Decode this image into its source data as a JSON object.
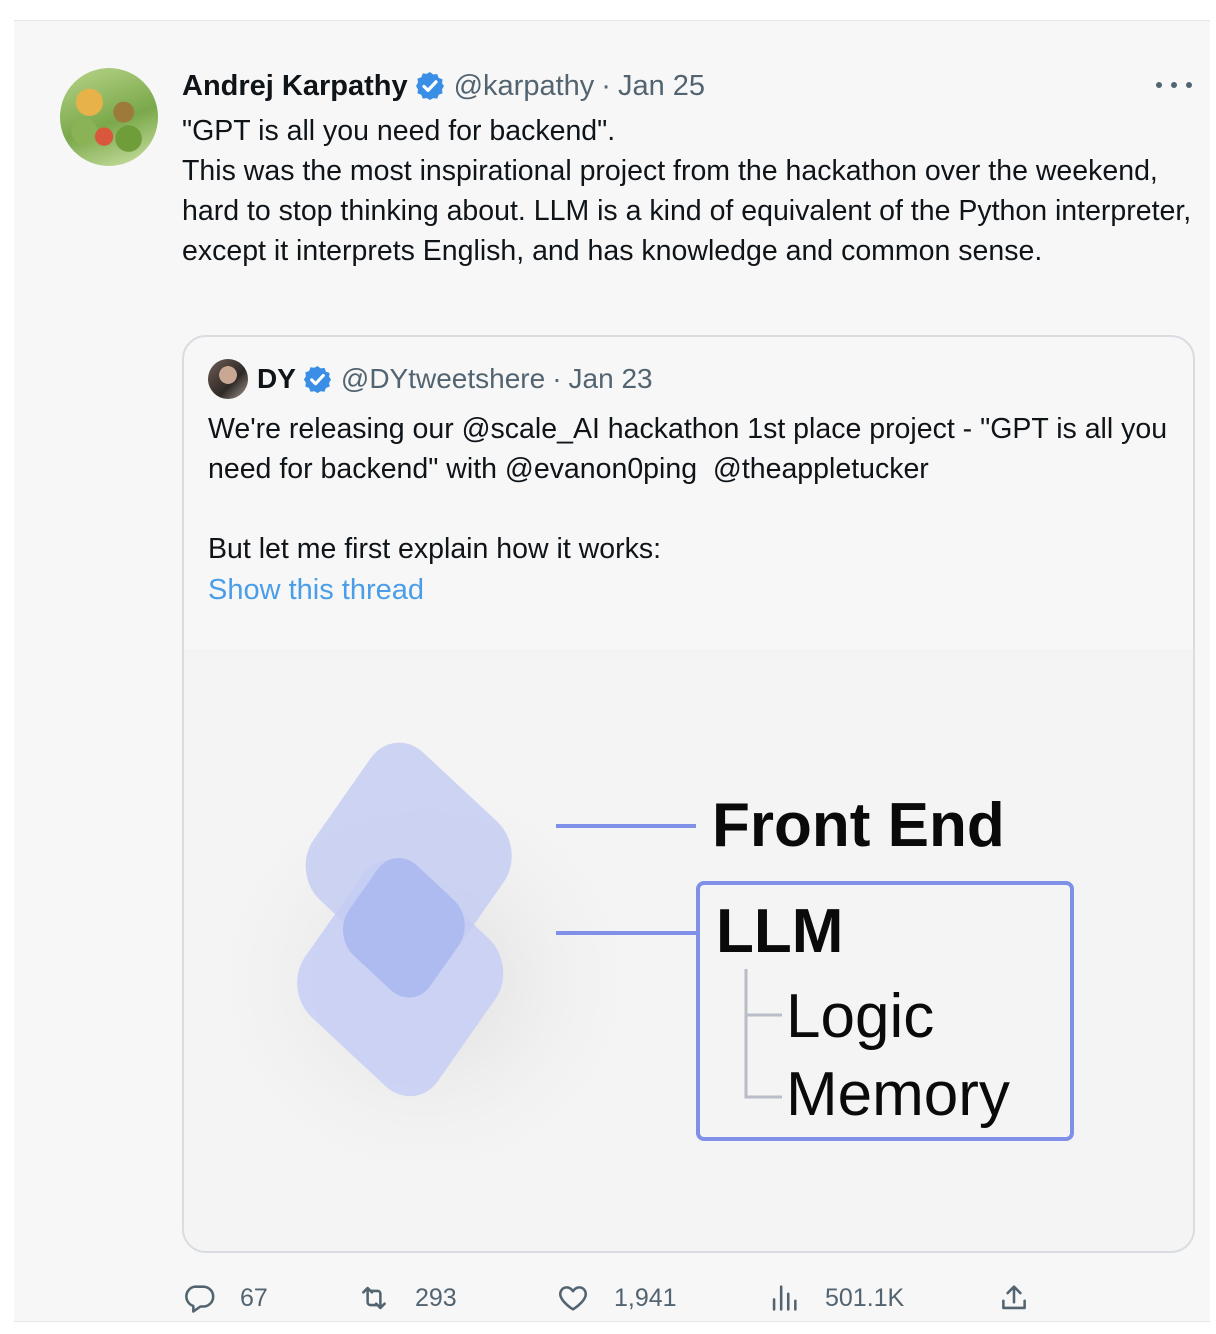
{
  "tweet": {
    "author_name": "Andrej Karpathy",
    "handle": "@karpathy",
    "separator": "·",
    "date": "Jan 25",
    "text_line1": "\"GPT is all you need for backend\".",
    "text_line2": "This was the most inspirational project from the hackathon over the weekend, hard to stop thinking about. LLM is a kind of equivalent of the Python interpreter, except it interprets English, and has knowledge and common sense."
  },
  "quote": {
    "author_name": "DY",
    "handle": "@DYtweetshere",
    "separator": "·",
    "date": "Jan 23",
    "text_before": "We're releasing our ",
    "mention1": "@scale_AI",
    "text_middle": " hackathon 1st place project - \"GPT is all you need for backend\" with ",
    "mention2": "@evanon0ping",
    "text_space": "  ",
    "mention3": "@theappletucker",
    "text_para2": "But let me first explain how it works:",
    "show_thread": "Show this thread"
  },
  "media": {
    "label_front_end": "Front End",
    "label_llm": "LLM",
    "label_logic": "Logic",
    "label_memory": "Memory"
  },
  "actions": {
    "replies": "67",
    "retweets": "293",
    "likes": "1,941",
    "views": "501.1K"
  },
  "colors": {
    "verified": "#3a8ee6",
    "link": "#4a9ee8",
    "diagram_accent": "#7f90e8"
  }
}
